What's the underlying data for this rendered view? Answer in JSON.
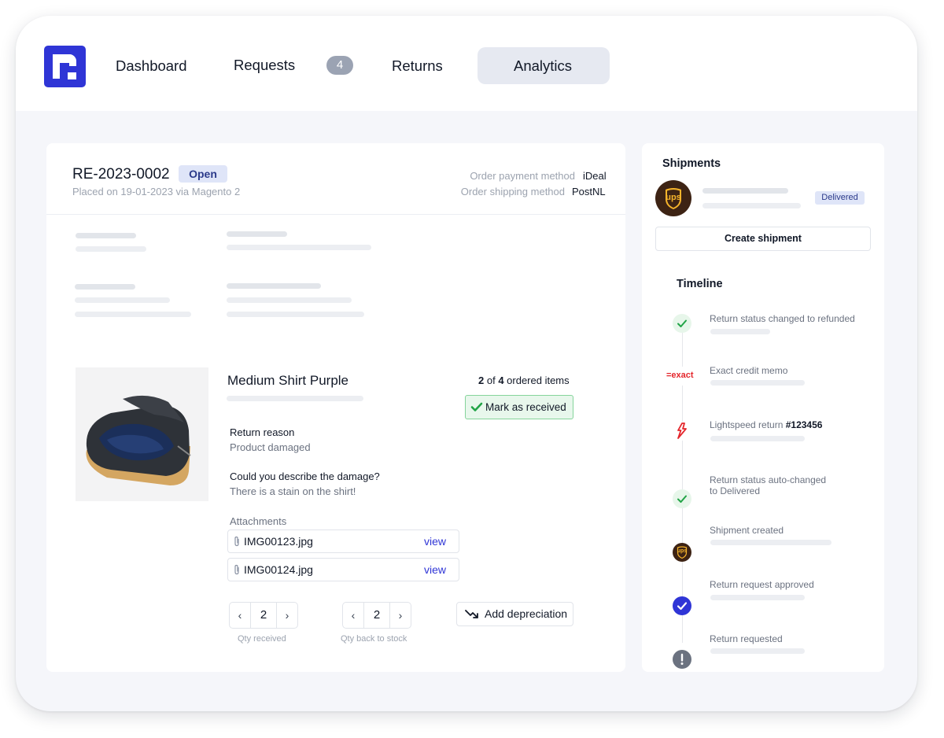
{
  "nav": {
    "dashboard": "Dashboard",
    "requests": "Requests",
    "requests_count": "4",
    "returns": "Returns",
    "analytics": "Analytics"
  },
  "order": {
    "id": "RE-2023-0002",
    "status": "Open",
    "placed": "Placed on 19-01-2023 via Magento 2",
    "payment_label": "Order payment method",
    "payment_value": "iDeal",
    "shipping_label": "Order shipping method",
    "shipping_value": "PostNL"
  },
  "item": {
    "name": "Medium Shirt Purple",
    "count_current": "2",
    "count_of": " of ",
    "count_total": "4",
    "count_suffix": " ordered items",
    "mark_received": "Mark as received",
    "return_reason_label": "Return reason",
    "return_reason_value": "Product damaged",
    "damage_question": "Could you describe the damage?",
    "damage_answer": "There is a stain on the shirt!",
    "attachments_label": "Attachments",
    "attachments": [
      {
        "name": "IMG00123.jpg",
        "action": "view"
      },
      {
        "name": "IMG00124.jpg",
        "action": "view"
      }
    ],
    "qty_received": "2",
    "qty_received_label": "Qty received",
    "qty_stock": "2",
    "qty_stock_label": "Qty back to stock",
    "add_depreciation": "Add depreciation"
  },
  "shipments": {
    "title": "Shipments",
    "carrier_logo_text": "ups",
    "status": "Delivered",
    "create_button": "Create shipment"
  },
  "timeline": {
    "title": "Timeline",
    "events": [
      {
        "text": "Return status changed to refunded",
        "icon": "check-icon"
      },
      {
        "text": "Exact credit memo",
        "icon": "exact-logo-icon",
        "logo_text": "=exact"
      },
      {
        "text": "Lightspeed return ",
        "bold": "#123456",
        "icon": "lightspeed-logo-icon"
      },
      {
        "text": "Return status auto-changed",
        "text2": "to Delivered",
        "icon": "check-icon"
      },
      {
        "text": "Shipment created",
        "icon": "ups-logo-icon",
        "logo_text": "ups"
      },
      {
        "text": "Return request approved",
        "icon": "check-circle-icon"
      },
      {
        "text": "Return requested",
        "icon": "exclamation-icon"
      }
    ]
  },
  "colors": {
    "brand": "#2f35d6",
    "success": "#22a447",
    "badge_bg": "#dfe5f8",
    "ups_brown": "#3d2314",
    "ups_gold": "#f6b42b",
    "exact_red": "#e4262c",
    "lightspeed_red": "#e4262c"
  }
}
